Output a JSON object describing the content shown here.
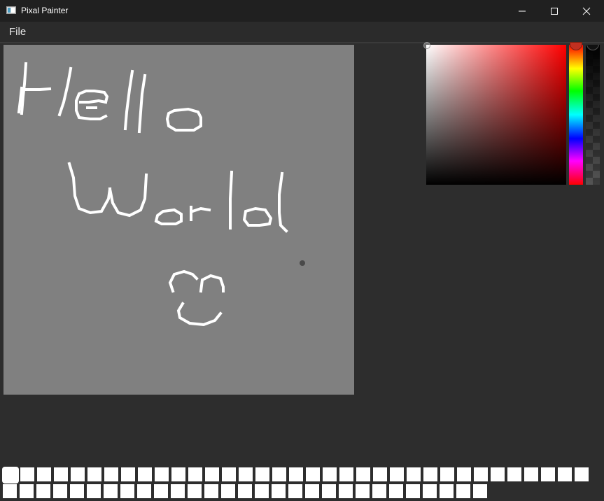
{
  "window": {
    "title": "Pixal Painter"
  },
  "menu": {
    "file_label": "File"
  },
  "canvas": {
    "background_color": "#808080",
    "stroke_color": "#ffffff"
  },
  "color_picker": {
    "current_hue_color": "#ff0000",
    "alpha_bar_color": "#000000"
  },
  "palette": {
    "row1_count": 35,
    "row2_count": 29,
    "swatch_color": "#ffffff",
    "selected_index": 0
  },
  "icons": {
    "app": "pixal-painter-app-icon",
    "minimize": "minimize-icon",
    "maximize": "maximize-icon",
    "close": "close-icon"
  }
}
